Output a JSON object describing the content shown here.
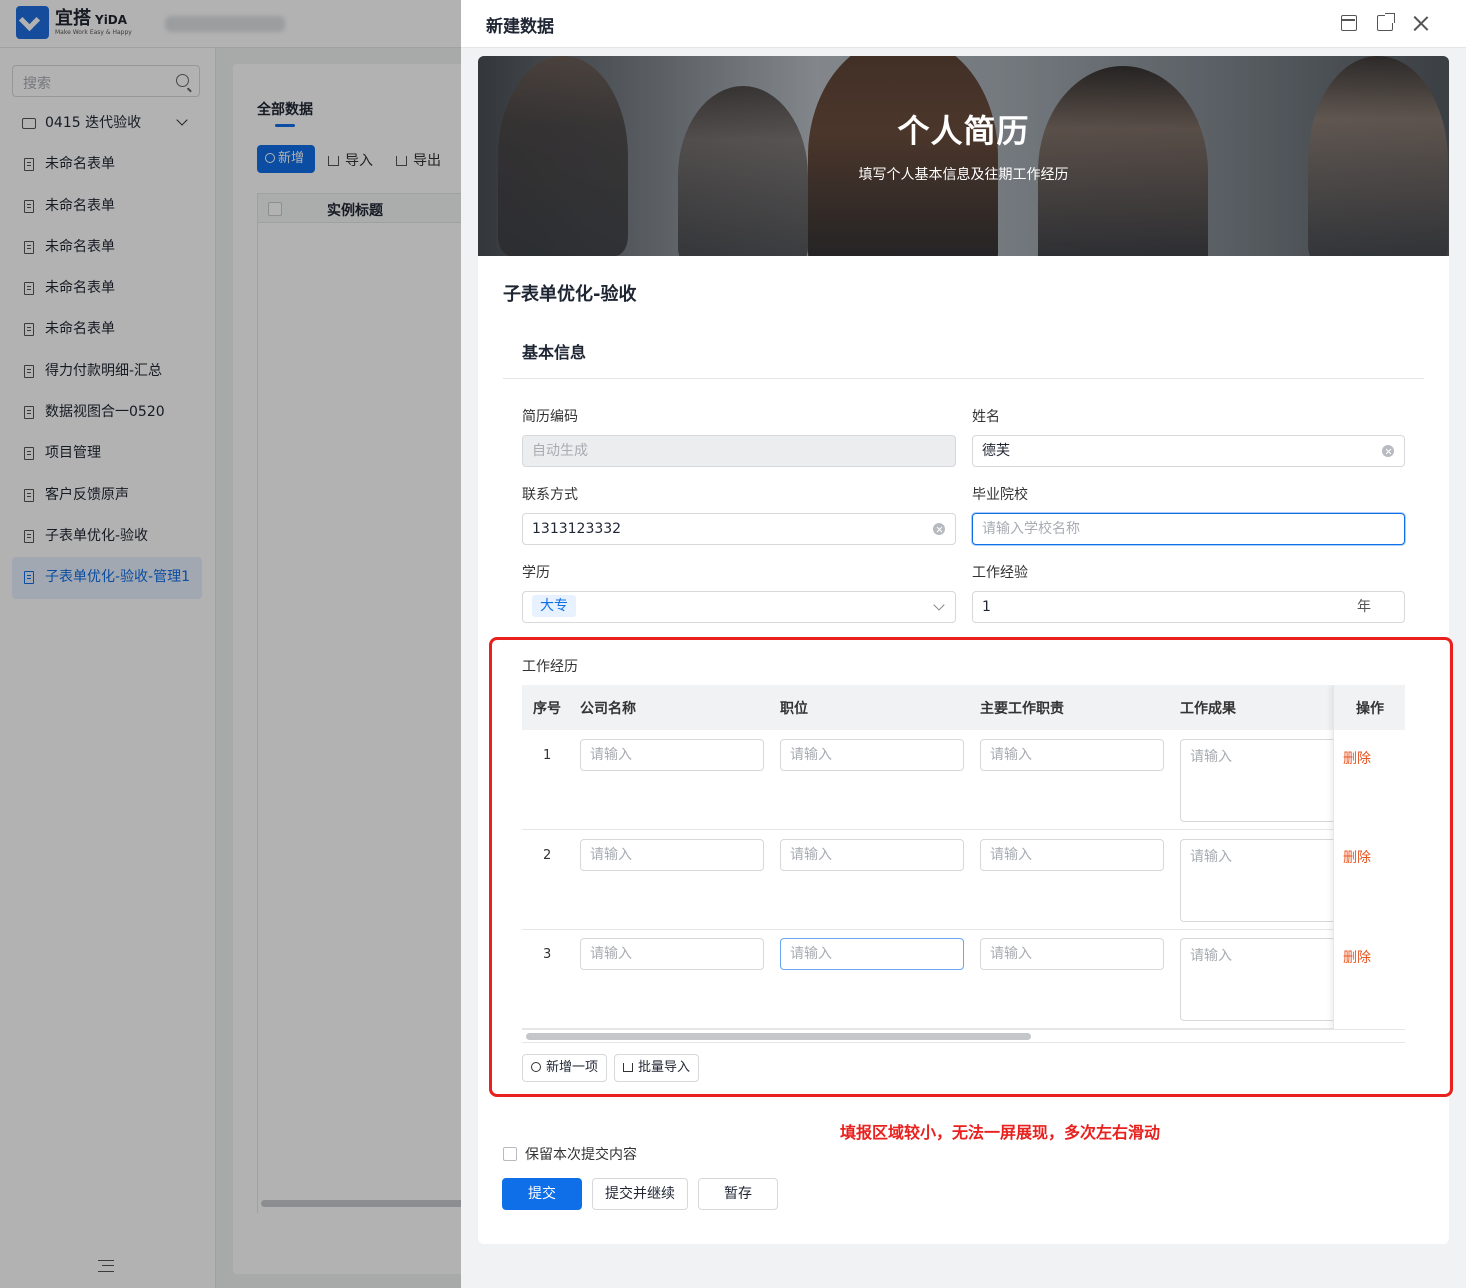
{
  "app": {
    "logo_title": "宜搭",
    "logo_title_en": "YiDA",
    "logo_sub": "Make Work Easy & Happy"
  },
  "sidebar": {
    "search_placeholder": "搜索",
    "folder_label": "0415 迭代验收",
    "items": [
      {
        "label": "未命名表单"
      },
      {
        "label": "未命名表单"
      },
      {
        "label": "未命名表单"
      },
      {
        "label": "未命名表单"
      },
      {
        "label": "未命名表单"
      },
      {
        "label": "得力付款明细-汇总"
      },
      {
        "label": "数据视图合一0520"
      },
      {
        "label": "项目管理"
      },
      {
        "label": "客户反馈原声"
      },
      {
        "label": "子表单优化-验收"
      },
      {
        "label": "子表单优化-验收-管理1"
      }
    ]
  },
  "main": {
    "tab_label": "全部数据",
    "add_label": "新增",
    "import_label": "导入",
    "export_label": "导出",
    "column_title": "实例标题"
  },
  "drawer": {
    "title": "新建数据",
    "banner_title": "个人简历",
    "banner_subtitle": "填写个人基本信息及往期工作经历",
    "form_name": "子表单优化-验收",
    "section_title": "基本信息",
    "fields": {
      "resume_code": {
        "label": "简历编码",
        "value": "自动生成"
      },
      "name": {
        "label": "姓名",
        "value": "德芙"
      },
      "contact": {
        "label": "联系方式",
        "value": "1313123332"
      },
      "school": {
        "label": "毕业院校",
        "placeholder": "请输入学校名称"
      },
      "education": {
        "label": "学历",
        "value": "大专"
      },
      "experience": {
        "label": "工作经验",
        "value": "1",
        "unit": "年"
      }
    },
    "subform": {
      "title": "工作经历",
      "columns": [
        "序号",
        "公司名称",
        "职位",
        "主要工作职责",
        "工作成果",
        "操作"
      ],
      "cell_placeholder": "请输入",
      "rows": [
        {
          "no": "1",
          "delete": "删除"
        },
        {
          "no": "2",
          "delete": "删除"
        },
        {
          "no": "3",
          "delete": "删除"
        }
      ],
      "add_item_label": "新增一项",
      "batch_import_label": "批量导入"
    },
    "annotation": "填报区域较小，无法一屏展现，多次左右滑动",
    "keep_label": "保留本次提交内容",
    "buttons": {
      "submit": "提交",
      "submit_continue": "提交并继续",
      "save_draft": "暂存"
    }
  },
  "colors": {
    "primary": "#0f6fe8",
    "danger_link": "#e8541e",
    "annotation_red": "#e8211e"
  }
}
